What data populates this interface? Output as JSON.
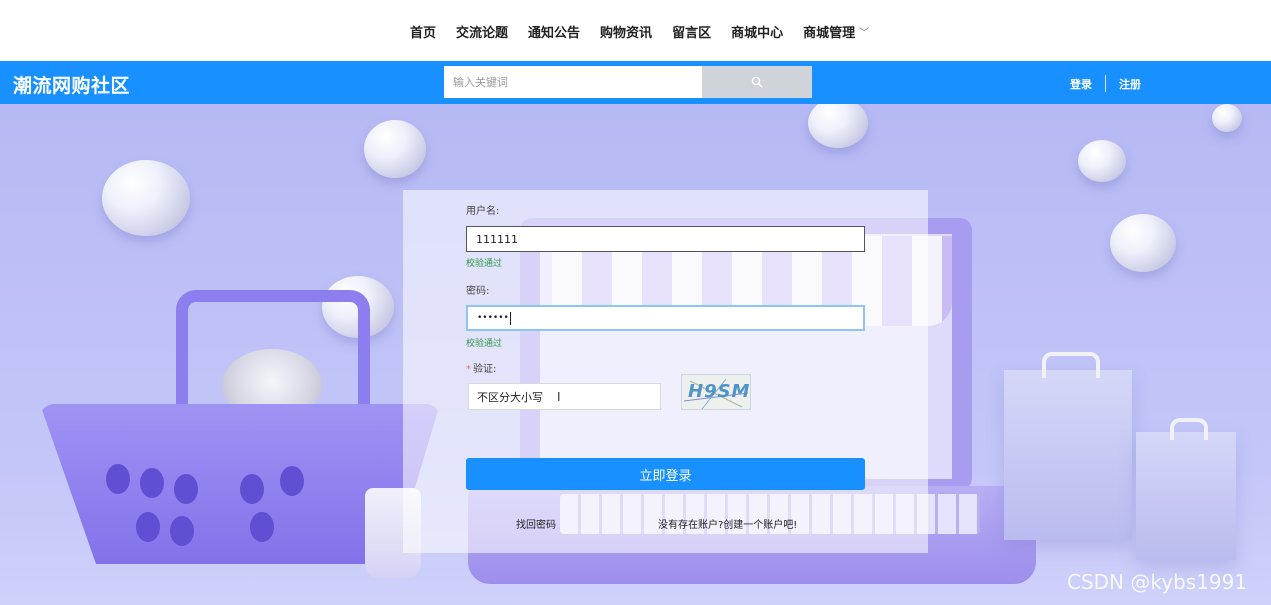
{
  "nav": {
    "items": [
      {
        "label": "首页"
      },
      {
        "label": "交流论题"
      },
      {
        "label": "通知公告"
      },
      {
        "label": "购物资讯"
      },
      {
        "label": "留言区"
      },
      {
        "label": "商城中心"
      },
      {
        "label": "商城管理",
        "has_dropdown": true
      }
    ]
  },
  "header": {
    "brand": "潮流网购社区",
    "search_placeholder": "输入关键词",
    "search_icon": "search-icon",
    "login_label": "登录",
    "register_label": "注册",
    "bg_color": "#1890ff"
  },
  "login_form": {
    "username_label": "用户名:",
    "username_value": "111111",
    "username_status": "校验通过",
    "password_label": "密码:",
    "password_value": "••••••",
    "password_status": "校验通过",
    "captcha_required_mark": "*",
    "captcha_label": "验证:",
    "captcha_value": "不区分大小写",
    "captcha_image_text": "H9SM",
    "submit_label": "立即登录",
    "forgot_link": "找回密码",
    "register_link": "没有存在账户?创建一个账户吧!",
    "valid_color": "#2e9b47",
    "button_color": "#1890ff"
  },
  "watermark": "CSDN @kybs1991"
}
